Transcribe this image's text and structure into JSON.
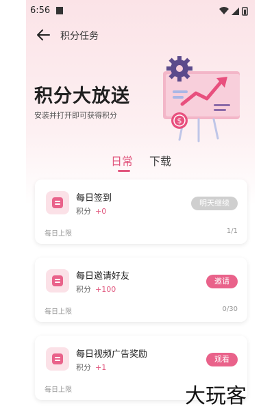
{
  "status_bar": {
    "time": "6:56"
  },
  "header": {
    "title": "积分任务"
  },
  "banner": {
    "title": "积分大放送",
    "subtitle": "安装并打开即可获得积分"
  },
  "tabs": [
    {
      "label": "日常",
      "selected": true
    },
    {
      "label": "下载",
      "selected": false
    }
  ],
  "tasks": [
    {
      "name": "每日签到",
      "points_label": "积分",
      "points_value": "+0",
      "action": "明天继续",
      "action_enabled": false,
      "limit_label": "每日上限",
      "limit_value": "1/1"
    },
    {
      "name": "每日邀请好友",
      "points_label": "积分",
      "points_value": "+100",
      "action": "邀请",
      "action_enabled": true,
      "limit_label": "每日上限",
      "limit_value": "0/30"
    },
    {
      "name": "每日视频广告奖励",
      "points_label": "积分",
      "points_value": "+1",
      "action": "观看",
      "action_enabled": true,
      "limit_label": "每日上限",
      "limit_value": ""
    }
  ],
  "watermark": "大玩客",
  "colors": {
    "accent": "#e1577e",
    "button": "#e9628a",
    "disabled": "#cfcfcf"
  }
}
